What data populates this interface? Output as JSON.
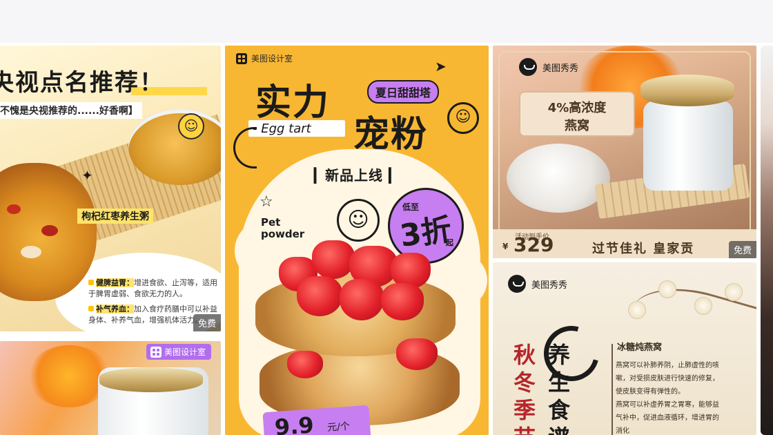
{
  "colors": {
    "topbar": "#f6f6f8",
    "free_badge_bg": "#3c3c3c",
    "tart_poster_bg": "#f8b732",
    "accent_purple": "#c77ef0",
    "deep_red": "#b5262a"
  },
  "cards": {
    "card1": {
      "headline": "央视点名推荐！",
      "quote": "不愧是央视推荐的......好香啊】",
      "dish_tag": "枸杞红枣养生粥",
      "benefit1_title": "健脾益胃：",
      "benefit1_text": "增进食欲、止泻等，适用于脾胃虚弱、食欲无力的人。",
      "benefit2_title": "补气养血：",
      "benefit2_text": "加入食疗药膳中可以补益身体、补养气血，增强机体活力。",
      "badge": "免费",
      "smile_icon": "smile-icon",
      "sparkle_icon": "sparkle-icon"
    },
    "card2": {
      "brand": "美图设计室",
      "brand_icon": "grid-logo-icon"
    },
    "card3": {
      "brand": "美图设计室",
      "title_line1": "实力",
      "title_line2": "宠粉",
      "subtitle_pill": "夏日甜甜塔",
      "egg_text": "- Egg tart",
      "new_label": "▎新品上线 ▎",
      "pet_line1": "Pet",
      "pet_line2": "powder",
      "discount_prefix": "低至",
      "discount_value": "3折",
      "discount_suffix": "起",
      "price_value": "9.9",
      "price_unit": "元/个"
    },
    "card4": {
      "brand": "美图秀秀",
      "concentration_line1": "4%高浓度",
      "concentration_line2": "燕窝",
      "activity_label": "活动到手价",
      "currency": "¥",
      "price": "329",
      "slogan": "过节佳礼 皇家贡",
      "badge": "免费"
    },
    "card5": {
      "brand": "美图秀秀",
      "red_col1": "秋",
      "red_col2": "冬",
      "red_col3": "季",
      "red_col4": "节",
      "dark_col1": "养",
      "dark_col2": "生",
      "dark_col3": "食",
      "dark_col4": "谱",
      "recipe_title": "冰糖炖燕窝",
      "recipe_para1": "燕窝可以补肺养阴，止肺虚性的咳嗽，对受损皮肤进行快速的修复，使皮肤变得有弹性的。",
      "recipe_para2": "燕窝可以补虚养胃之胃寒，能够益气补中，促进血液循环，增进胃的消化"
    }
  }
}
